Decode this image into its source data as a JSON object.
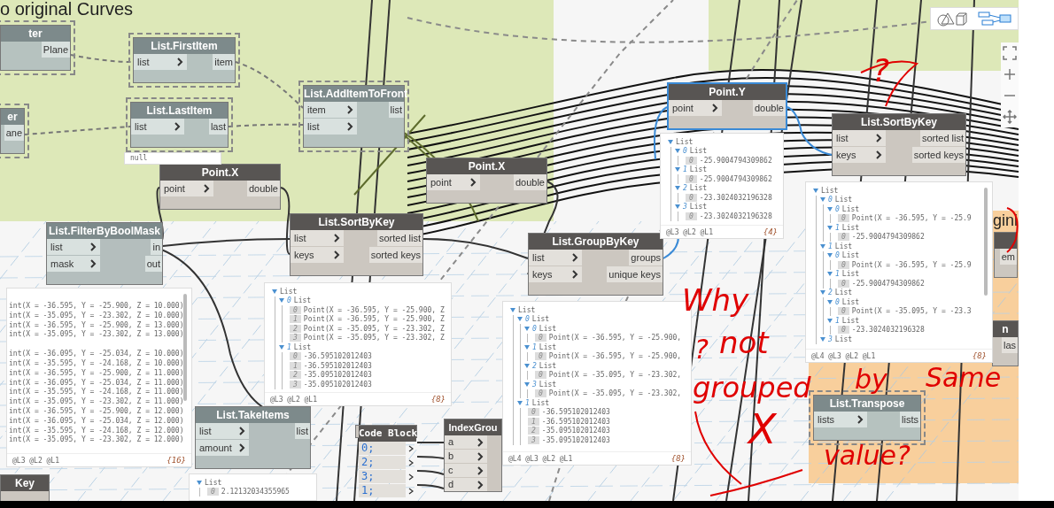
{
  "group_titles": [
    {
      "text": "o original Curves"
    },
    {
      "text": "gini"
    }
  ],
  "nodes": [
    {
      "title": "ter",
      "kind": "frozen",
      "selected": false,
      "outputs": [
        "Plane"
      ]
    },
    {
      "title": "List.FirstItem",
      "kind": "frozen",
      "selected": false,
      "inputs": [
        "list"
      ],
      "outputs": [
        "item"
      ]
    },
    {
      "title": "List.AddItemToFront",
      "kind": "frozen",
      "selected": false,
      "inputs": [
        "item",
        "list"
      ],
      "outputs": [
        "list"
      ]
    },
    {
      "title": "Point.Y",
      "kind": "normal",
      "selected": true,
      "inputs": [
        "point"
      ],
      "outputs": [
        "double"
      ]
    },
    {
      "title": "er",
      "kind": "frozen",
      "selected": false,
      "outputs": [
        "ane"
      ]
    },
    {
      "title": "List.LastItem",
      "kind": "frozen",
      "selected": false,
      "inputs": [
        "list"
      ],
      "outputs": [
        "last"
      ]
    },
    {
      "title": "List.SortByKey",
      "kind": "normal",
      "selected": false,
      "inputs": [
        "list",
        "keys"
      ],
      "outputs": [
        "sorted list",
        "sorted keys"
      ]
    },
    {
      "title": "Point.X",
      "kind": "normal",
      "selected": false,
      "inputs": [
        "point"
      ],
      "outputs": [
        "double"
      ]
    },
    {
      "title": "Point.X",
      "kind": "normal",
      "selected": false,
      "inputs": [
        "point"
      ],
      "outputs": [
        "double"
      ]
    },
    {
      "title": "List.FilterByBoolMask",
      "kind": "preview_off",
      "selected": false,
      "inputs": [
        "list",
        "mask"
      ],
      "outputs": [
        "in",
        "out"
      ]
    },
    {
      "title": "List.SortByKey",
      "kind": "normal",
      "selected": false,
      "inputs": [
        "list",
        "keys"
      ],
      "outputs": [
        "sorted list",
        "sorted keys"
      ]
    },
    {
      "title": "List.GroupByKey",
      "kind": "normal",
      "selected": false,
      "inputs": [
        "list",
        "keys"
      ],
      "outputs": [
        "groups",
        "unique keys"
      ]
    },
    {
      "kind": "normal",
      "selected": false,
      "outputs": [
        "em"
      ]
    },
    {
      "title": "n",
      "kind": "normal",
      "selected": false,
      "outputs": [
        "las"
      ]
    },
    {
      "title": "List.Transpose",
      "kind": "frozen",
      "selected": false,
      "inputs": [
        "lists"
      ],
      "outputs": [
        "lists"
      ]
    },
    {
      "title": "Key",
      "kind": "normal",
      "selected": false
    },
    {
      "title": "List.TakeItems",
      "kind": "preview_off",
      "selected": false,
      "inputs": [
        "list",
        "amount"
      ],
      "outputs": [
        "list"
      ]
    },
    {
      "title": "Code Block",
      "kind": "code",
      "selected": false,
      "lines": [
        "0;",
        "2;",
        "3;",
        "1;"
      ]
    },
    {
      "title": "IndexGrou",
      "kind": "normal",
      "selected": false,
      "inputs": [
        "a",
        "b",
        "c",
        "d"
      ]
    }
  ],
  "previews": [
    {
      "kind": "text",
      "text": "null"
    },
    {
      "kind": "tree",
      "levels": "@L3 @L2 @L1",
      "count": "{4}",
      "tree": [
        {
          "label": "List",
          "children": [
            {
              "index": "0",
              "label": "List",
              "children": [
                {
                  "index": "0",
                  "value": "-25.9004794309862"
                }
              ]
            },
            {
              "index": "1",
              "label": "List",
              "children": [
                {
                  "index": "0",
                  "value": "-25.9004794309862"
                }
              ]
            },
            {
              "index": "2",
              "label": "List",
              "children": [
                {
                  "index": "0",
                  "value": "-23.3024032196328"
                }
              ]
            },
            {
              "index": "3",
              "label": "List",
              "children": [
                {
                  "index": "0",
                  "value": "-23.3024032196328"
                }
              ]
            }
          ]
        }
      ]
    },
    {
      "kind": "tree",
      "levels": "@L4 @L3 @L2 @L1",
      "count": "{8}",
      "tree": [
        {
          "label": "List",
          "children": [
            {
              "index": "0",
              "label": "List",
              "children": [
                {
                  "index": "0",
                  "label": "List",
                  "children": [
                    {
                      "index": "0",
                      "value": "Point(X = -36.595, Y = -25.9"
                    }
                  ]
                },
                {
                  "index": "1",
                  "label": "List",
                  "children": [
                    {
                      "index": "0",
                      "value": "-25.9004794309862"
                    }
                  ]
                }
              ]
            },
            {
              "index": "1",
              "label": "List",
              "children": [
                {
                  "index": "0",
                  "label": "List",
                  "children": [
                    {
                      "index": "0",
                      "value": "Point(X = -36.595, Y = -25.9"
                    }
                  ]
                },
                {
                  "index": "1",
                  "label": "List",
                  "children": [
                    {
                      "index": "0",
                      "value": "-25.9004794309862"
                    }
                  ]
                }
              ]
            },
            {
              "index": "2",
              "label": "List",
              "children": [
                {
                  "index": "0",
                  "label": "List",
                  "children": [
                    {
                      "index": "0",
                      "value": "Point(X = -35.095, Y = -23.3"
                    }
                  ]
                },
                {
                  "index": "1",
                  "label": "List",
                  "children": [
                    {
                      "index": "0",
                      "value": "-23.3024032196328"
                    }
                  ]
                }
              ]
            },
            {
              "index": "3",
              "label": "List"
            }
          ]
        }
      ]
    },
    {
      "kind": "flat",
      "levels": "@L3 @L2 @L1",
      "count": "{16}",
      "groups": [
        [
          "int(X = -36.595, Y = -25.900, Z = 10.000)",
          "int(X = -35.095, Y = -23.302, Z = 10.000)",
          "int(X = -36.595, Y = -25.900, Z = 13.000)",
          "int(X = -35.095, Y = -23.302, Z = 13.000)"
        ],
        [
          "int(X = -36.095, Y = -25.034, Z = 10.000)",
          "int(X = -35.595, Y = -24.168, Z = 10.000)",
          "int(X = -36.595, Y = -25.900, Z = 11.000)",
          "int(X = -36.095, Y = -25.034, Z = 11.000)",
          "int(X = -35.595, Y = -24.168, Z = 11.000)",
          "int(X = -35.095, Y = -23.302, Z = 11.000)",
          "int(X = -36.595, Y = -25.900, Z = 12.000)",
          "int(X = -36.095, Y = -25.034, Z = 12.000)",
          "int(X = -35.595, Y = -24.168, Z = 12.000)",
          "int(X = -35.095, Y = -23.302, Z = 12.000)"
        ]
      ]
    },
    {
      "kind": "tree",
      "levels": "@L3 @L2 @L1",
      "count": "{8}",
      "tree": [
        {
          "label": "List",
          "children": [
            {
              "index": "0",
              "label": "List",
              "children": [
                {
                  "index": "0",
                  "value": "Point(X = -36.595, Y = -25.900, Z"
                },
                {
                  "index": "1",
                  "value": "Point(X = -36.595, Y = -25.900, Z"
                },
                {
                  "index": "2",
                  "value": "Point(X = -35.095, Y = -23.302, Z"
                },
                {
                  "index": "3",
                  "value": "Point(X = -35.095, Y = -23.302, Z"
                }
              ]
            },
            {
              "index": "1",
              "label": "List",
              "children": [
                {
                  "index": "0",
                  "value": "-36.595102012403"
                },
                {
                  "index": "1",
                  "value": "-36.595102012403"
                },
                {
                  "index": "2",
                  "value": "-35.095102012403"
                },
                {
                  "index": "3",
                  "value": "-35.095102012403"
                }
              ]
            }
          ]
        }
      ]
    },
    {
      "kind": "tree",
      "levels": "@L4 @L3 @L2 @L1",
      "count": "{8}",
      "tree": [
        {
          "label": "List",
          "children": [
            {
              "index": "0",
              "label": "List",
              "children": [
                {
                  "index": "0",
                  "label": "List",
                  "children": [
                    {
                      "index": "0",
                      "value": "Point(X = -36.595, Y = -25.900,"
                    }
                  ]
                },
                {
                  "index": "1",
                  "label": "List",
                  "children": [
                    {
                      "index": "0",
                      "value": "Point(X = -36.595, Y = -25.900,"
                    }
                  ]
                },
                {
                  "index": "2",
                  "label": "List",
                  "children": [
                    {
                      "index": "0",
                      "value": "Point(X = -35.095, Y = -23.302,"
                    }
                  ]
                },
                {
                  "index": "3",
                  "label": "List",
                  "children": [
                    {
                      "index": "0",
                      "value": "Point(X = -35.095, Y = -23.302,"
                    }
                  ]
                }
              ]
            },
            {
              "index": "1",
              "label": "List",
              "children": [
                {
                  "index": "0",
                  "value": "-36.595102012403"
                },
                {
                  "index": "1",
                  "value": "-36.595102012403"
                },
                {
                  "index": "2",
                  "value": "-35.095102012403"
                },
                {
                  "index": "3",
                  "value": "-35.095102012403"
                }
              ]
            }
          ]
        }
      ]
    },
    {
      "kind": "tree",
      "tree": [
        {
          "label": "List",
          "children": [
            {
              "index": "0",
              "value": "2.12132034355965"
            }
          ]
        }
      ]
    }
  ],
  "annotation": [
    {
      "text": "Why"
    },
    {
      "text": "not"
    },
    {
      "text": "grouped"
    },
    {
      "text": "by"
    },
    {
      "text": "Same"
    },
    {
      "text": "X"
    },
    {
      "text": "value?"
    },
    {
      "text": "?"
    },
    {
      "text": "?"
    }
  ]
}
